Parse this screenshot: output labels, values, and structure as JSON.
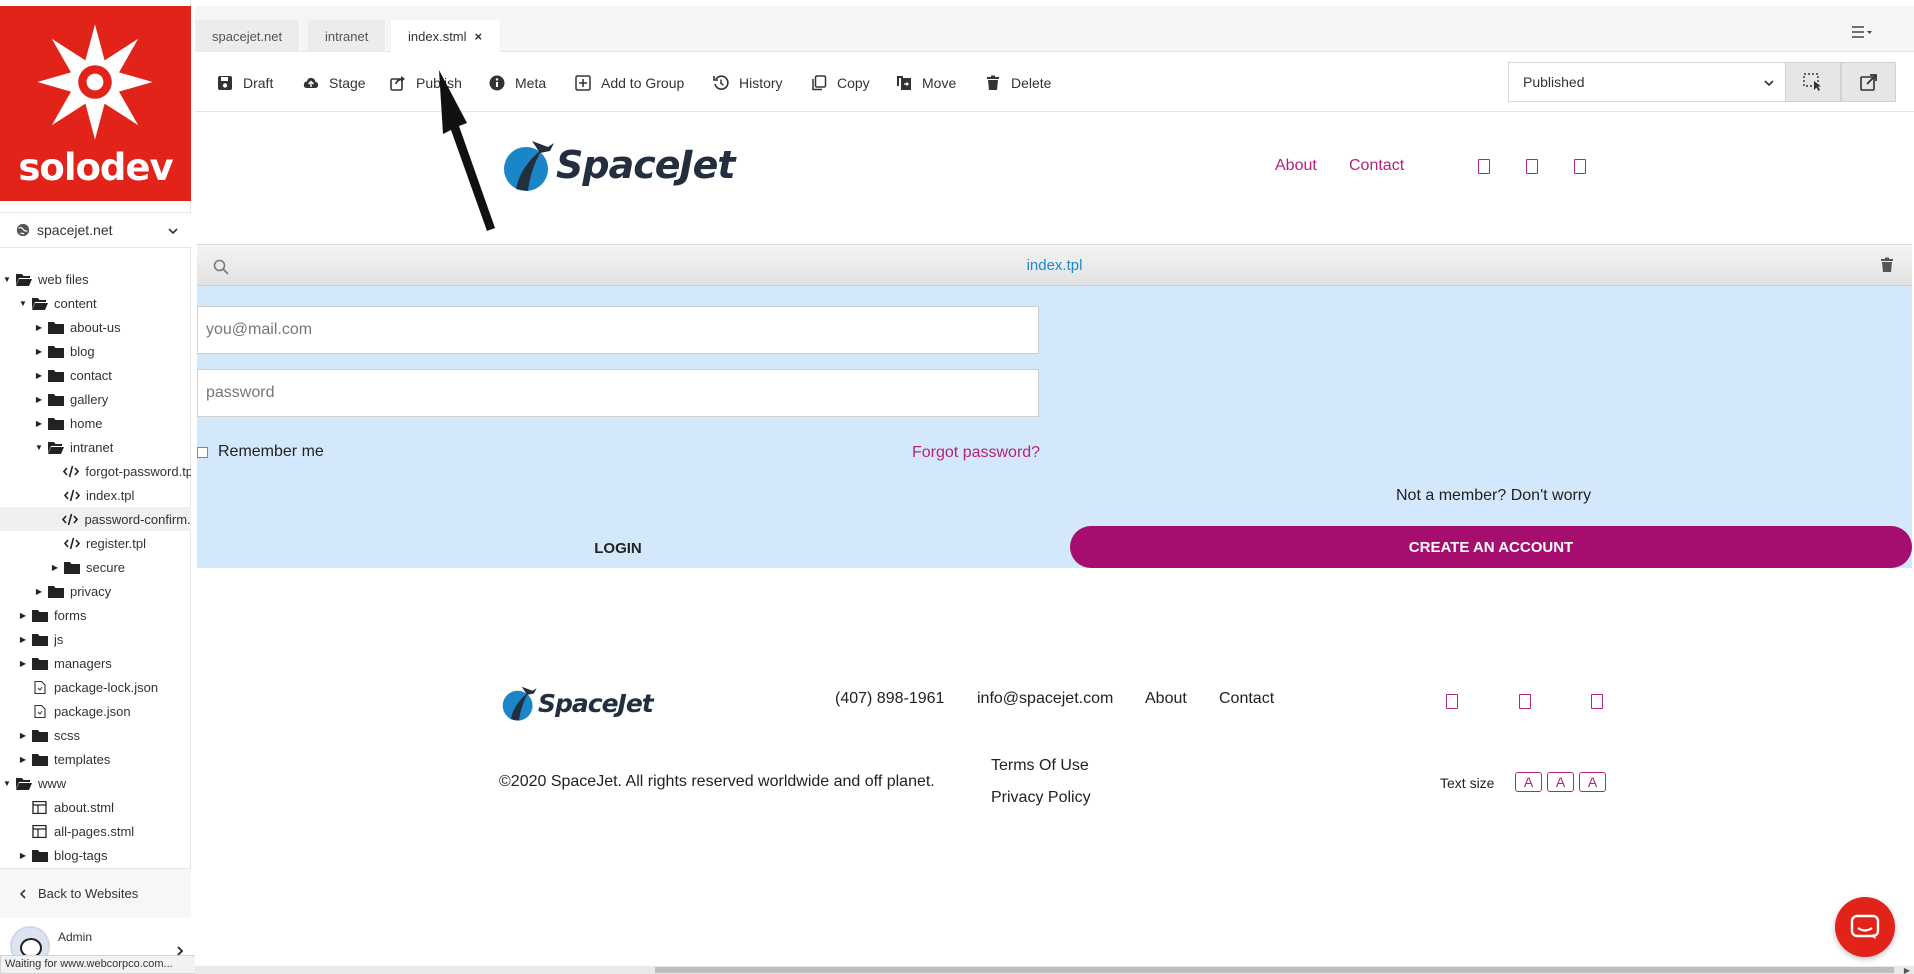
{
  "colors": {
    "brand_red": "#e2231a",
    "accent_magenta": "#b5227b",
    "create_button": "#a50e6e",
    "template_link": "#1d8acb",
    "login_area_bg": "#d4e8fc"
  },
  "sidebar": {
    "brand": "solodev",
    "site_selector": "spacejet.net",
    "tree": [
      {
        "label": "web files",
        "type": "folder-open",
        "caret": "down"
      },
      {
        "label": "content",
        "type": "folder-open",
        "caret": "down"
      },
      {
        "label": "about-us",
        "type": "folder",
        "caret": "right"
      },
      {
        "label": "blog",
        "type": "folder",
        "caret": "right"
      },
      {
        "label": "contact",
        "type": "folder",
        "caret": "right"
      },
      {
        "label": "gallery",
        "type": "folder",
        "caret": "right"
      },
      {
        "label": "home",
        "type": "folder",
        "caret": "right"
      },
      {
        "label": "intranet",
        "type": "folder-open",
        "caret": "down"
      },
      {
        "label": "forgot-password.tpl",
        "type": "code",
        "caret": ""
      },
      {
        "label": "index.tpl",
        "type": "code",
        "caret": ""
      },
      {
        "label": "password-confirm.tpl",
        "type": "code",
        "caret": "",
        "selected": true
      },
      {
        "label": "register.tpl",
        "type": "code",
        "caret": ""
      },
      {
        "label": "secure",
        "type": "folder",
        "caret": "right"
      },
      {
        "label": "privacy",
        "type": "folder",
        "caret": "right"
      },
      {
        "label": "forms",
        "type": "folder",
        "caret": "right"
      },
      {
        "label": "js",
        "type": "folder",
        "caret": "right"
      },
      {
        "label": "managers",
        "type": "folder",
        "caret": "right"
      },
      {
        "label": "package-lock.json",
        "type": "file",
        "caret": ""
      },
      {
        "label": "package.json",
        "type": "file",
        "caret": ""
      },
      {
        "label": "scss",
        "type": "folder",
        "caret": "right"
      },
      {
        "label": "templates",
        "type": "folder",
        "caret": "right"
      },
      {
        "label": "www",
        "type": "folder-open",
        "caret": "down"
      },
      {
        "label": "about.stml",
        "type": "table",
        "caret": ""
      },
      {
        "label": "all-pages.stml",
        "type": "table",
        "caret": ""
      },
      {
        "label": "blog-tags",
        "type": "folder",
        "caret": "right"
      }
    ],
    "back_label": "Back to Websites",
    "user_name": "Admin",
    "status_tip": "Waiting for www.webcorpco.com..."
  },
  "tabs": [
    {
      "label": "spacejet.net"
    },
    {
      "label": "intranet"
    },
    {
      "label": "index.stml",
      "close": "×"
    }
  ],
  "toolbar": {
    "buttons": [
      "Draft",
      "Stage",
      "Publish",
      "Meta",
      "Add to Group",
      "History",
      "Copy",
      "Move",
      "Delete"
    ],
    "status_value": "Published"
  },
  "preview": {
    "logo_text": "SpaceJet",
    "nav": [
      "About",
      "Contact"
    ],
    "template_name": "index.tpl",
    "email_placeholder": "you@mail.com",
    "password_placeholder": "password",
    "remember_me": "Remember me",
    "forgot_password": "Forgot password?",
    "not_member": "Not a member? Don't worry",
    "login_label": "LOGIN",
    "create_label": "CREATE AN ACCOUNT",
    "footer": {
      "phone": "(407) 898-1961",
      "email": "info@spacejet.com",
      "about": "About",
      "contact": "Contact",
      "copyright": "©2020 SpaceJet. All rights reserved worldwide and off planet.",
      "terms": "Terms Of Use",
      "privacy": "Privacy Policy",
      "text_size_label": "Text size",
      "text_size_buttons": [
        "A",
        "A",
        "A"
      ]
    }
  }
}
